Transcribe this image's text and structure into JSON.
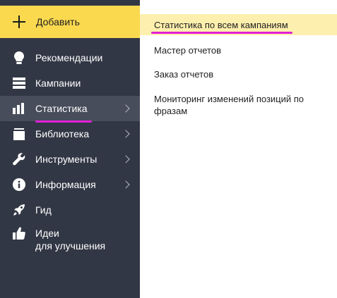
{
  "add_button": {
    "label": "Добавить",
    "icon": "plus-icon"
  },
  "nav": {
    "items": [
      {
        "label": "Рекомендации",
        "icon": "lightbulb-icon",
        "has_submenu": false
      },
      {
        "label": "Кампании",
        "icon": "list-icon",
        "has_submenu": false
      },
      {
        "label": "Статистика",
        "icon": "bar-chart-icon",
        "has_submenu": true,
        "active": true
      },
      {
        "label": "Библиотека",
        "icon": "library-icon",
        "has_submenu": true
      },
      {
        "label": "Инструменты",
        "icon": "wrench-icon",
        "has_submenu": true
      },
      {
        "label": "Информация",
        "icon": "info-icon",
        "has_submenu": true
      },
      {
        "label": "Гид",
        "icon": "rocket-icon",
        "has_submenu": false
      },
      {
        "label_line1": "Идеи",
        "label_line2": "для улучшения",
        "icon": "thumbs-up-icon",
        "has_submenu": false
      }
    ]
  },
  "submenu": {
    "items": [
      {
        "label": "Статистика по всем кампаниям",
        "active": true
      },
      {
        "label": "Мастер отчетов"
      },
      {
        "label": "Заказ отчетов"
      },
      {
        "label_line1": "Мониторинг изменений позиций по",
        "label_line2": "фразам"
      }
    ]
  },
  "colors": {
    "sidebar_bg": "#323745",
    "add_button_bg": "#fad94f",
    "active_nav_bg": "#474d5b",
    "active_sub_bg": "#fdefad",
    "highlight_underline": "#e020d7"
  }
}
